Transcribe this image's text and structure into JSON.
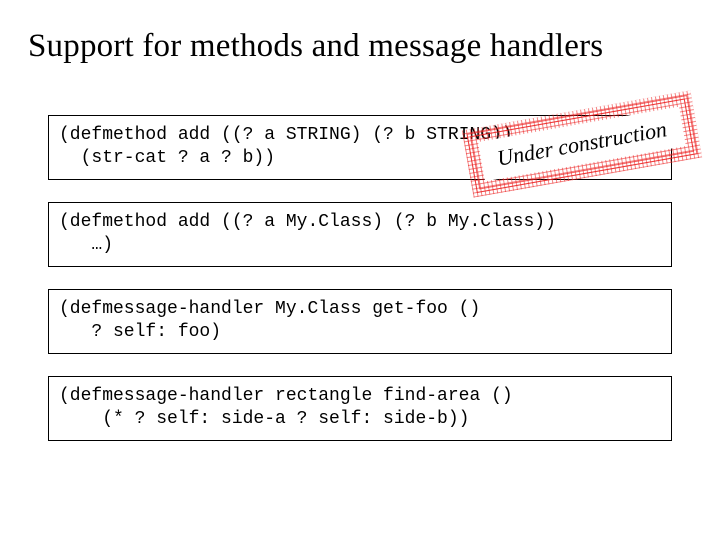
{
  "title": "Support for methods and message handlers",
  "stamp": {
    "text": "Under construction"
  },
  "code_boxes": [
    "(defmethod add ((? a STRING) (? b STRING))\n  (str-cat ? a ? b))",
    "(defmethod add ((? a My.Class) (? b My.Class))\n   …)",
    "(defmessage-handler My.Class get-foo ()\n   ? self: foo)",
    "(defmessage-handler rectangle find-area ()\n    (* ? self: side-a ? self: side-b))"
  ]
}
